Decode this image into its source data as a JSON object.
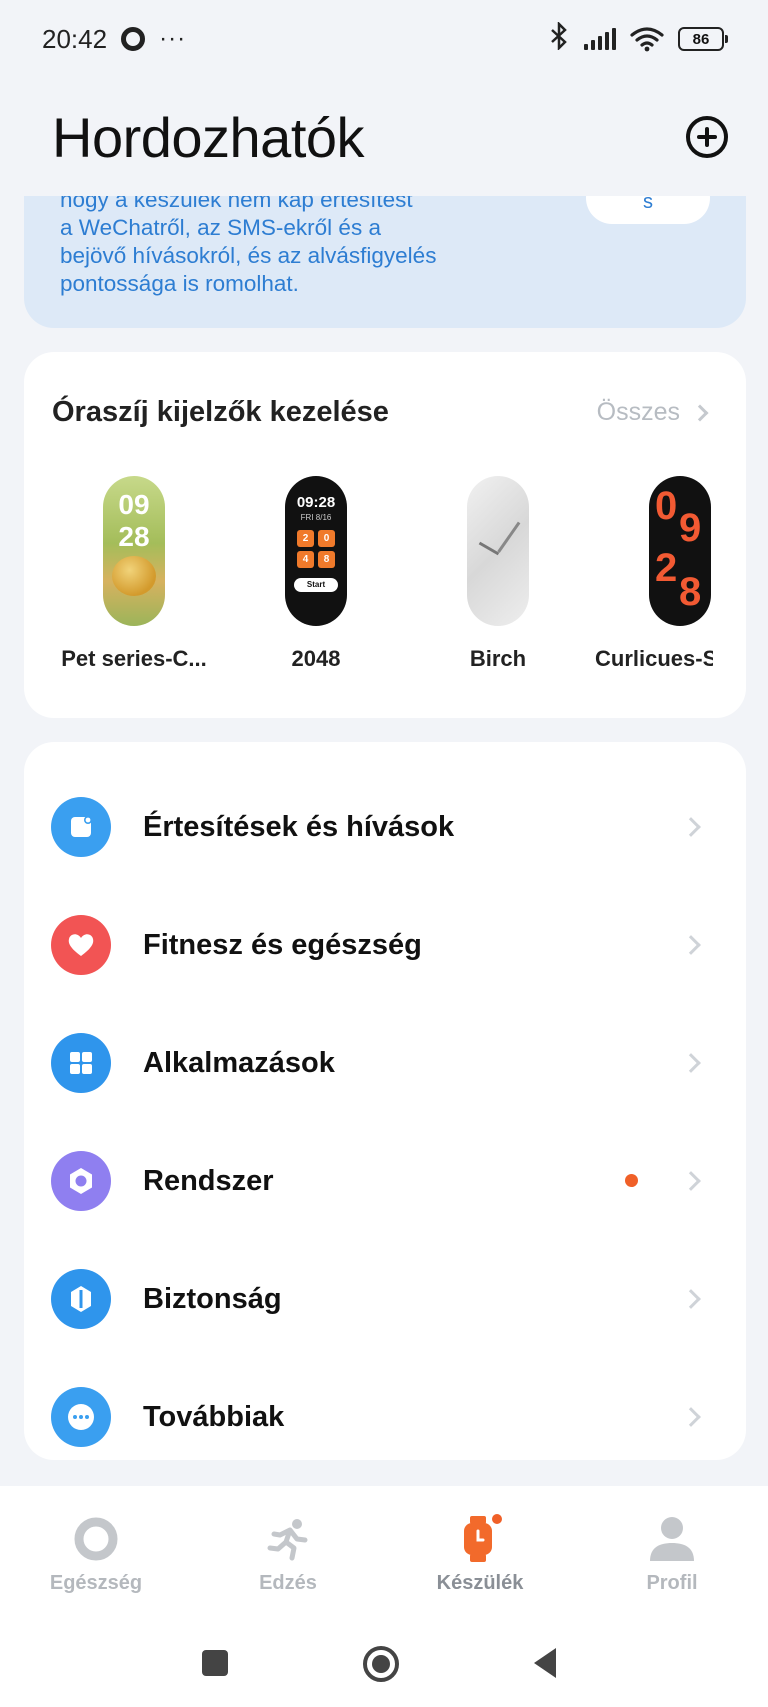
{
  "status_bar": {
    "time": "20:42",
    "more": "···",
    "battery": "86"
  },
  "header": {
    "title": "Hordozhatók"
  },
  "banner": {
    "text_lines": [
      "hogy a készülék nem kap értesítést",
      "a WeChatről, az SMS-ekről és a",
      "bejövő hívásokról, és az alvásfigyelés",
      "pontossága is romolhat."
    ],
    "button_label": "s"
  },
  "faces": {
    "title": "Óraszíj kijelzők kezelése",
    "see_all": "Összes",
    "items": [
      {
        "label": "Pet series-C...",
        "time_top": "09",
        "time_bottom": "28"
      },
      {
        "label": "2048",
        "time": "09:28",
        "date": "FRI 8/16",
        "tiles": [
          "2",
          "0",
          "4",
          "8"
        ],
        "start": "Start"
      },
      {
        "label": "Birch"
      },
      {
        "label": "Curlicues-S",
        "digit_a": "0",
        "digit_b": "9",
        "digit_c": "2",
        "digit_d": "8"
      }
    ]
  },
  "menu": {
    "items": [
      {
        "label": "Értesítések és hívások",
        "icon": "notification-icon",
        "color": "#3a9ff0"
      },
      {
        "label": "Fitnesz és egészség",
        "icon": "heart-icon",
        "color": "#f25454"
      },
      {
        "label": "Alkalmazások",
        "icon": "apps-icon",
        "color": "#2f95ec"
      },
      {
        "label": "Rendszer",
        "icon": "system-icon",
        "color": "#8f7ff0"
      },
      {
        "label": "Biztonság",
        "icon": "shield-icon",
        "color": "#2f95ec"
      },
      {
        "label": "Továbbiak",
        "icon": "more-icon",
        "color": "#3a9ff0"
      }
    ]
  },
  "tabs": [
    {
      "label": "Egészség",
      "icon": "health-ring-icon"
    },
    {
      "label": "Edzés",
      "icon": "running-icon"
    },
    {
      "label": "Készülék",
      "icon": "watch-icon",
      "active": true
    },
    {
      "label": "Profil",
      "icon": "profile-icon"
    }
  ],
  "colors": {
    "accent": "#2d7dd2",
    "active_tab": "#f26a2b",
    "badge": "#f06028"
  }
}
